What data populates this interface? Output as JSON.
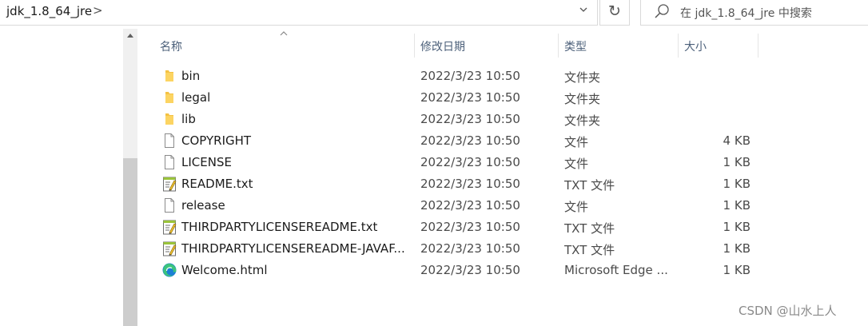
{
  "address_bar": {
    "path": "jdk_1.8_64_jre",
    "separator": ">",
    "dropdown_glyph": "⌄",
    "refresh_glyph": "↻"
  },
  "search": {
    "placeholder": "在 jdk_1.8_64_jre 中搜索"
  },
  "columns": {
    "name": "名称",
    "date": "修改日期",
    "type": "类型",
    "size": "大小",
    "sort_glyph": "^"
  },
  "files": [
    {
      "name": "bin",
      "date": "2022/3/23 10:50",
      "type": "文件夹",
      "size": "",
      "icon": "folder-icon"
    },
    {
      "name": "legal",
      "date": "2022/3/23 10:50",
      "type": "文件夹",
      "size": "",
      "icon": "folder-icon"
    },
    {
      "name": "lib",
      "date": "2022/3/23 10:50",
      "type": "文件夹",
      "size": "",
      "icon": "folder-icon"
    },
    {
      "name": "COPYRIGHT",
      "date": "2022/3/23 10:50",
      "type": "文件",
      "size": "4 KB",
      "icon": "file-icon"
    },
    {
      "name": "LICENSE",
      "date": "2022/3/23 10:50",
      "type": "文件",
      "size": "1 KB",
      "icon": "file-icon"
    },
    {
      "name": "README.txt",
      "date": "2022/3/23 10:50",
      "type": "TXT 文件",
      "size": "1 KB",
      "icon": "text-file-icon"
    },
    {
      "name": "release",
      "date": "2022/3/23 10:50",
      "type": "文件",
      "size": "1 KB",
      "icon": "file-icon"
    },
    {
      "name": "THIRDPARTYLICENSEREADME.txt",
      "date": "2022/3/23 10:50",
      "type": "TXT 文件",
      "size": "1 KB",
      "icon": "text-file-icon"
    },
    {
      "name": "THIRDPARTYLICENSEREADME-JAVAF...",
      "date": "2022/3/23 10:50",
      "type": "TXT 文件",
      "size": "1 KB",
      "icon": "text-file-icon"
    },
    {
      "name": "Welcome.html",
      "date": "2022/3/23 10:50",
      "type": "Microsoft Edge ...",
      "size": "1 KB",
      "icon": "edge-icon"
    }
  ],
  "watermark": "CSDN @山水上人",
  "colors": {
    "folder": "#f4c244",
    "header_text": "#4c607a",
    "edge_blue": "#1b7fd6",
    "edge_green": "#3cc47c"
  }
}
